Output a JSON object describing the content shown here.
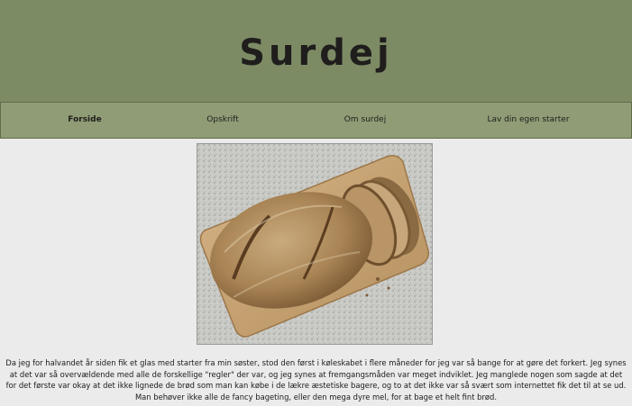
{
  "header": {
    "title": "Surdej"
  },
  "nav": {
    "items": [
      {
        "label": "Forside",
        "active": true
      },
      {
        "label": "Opskrift",
        "active": false
      },
      {
        "label": "Om surdej",
        "active": false
      },
      {
        "label": "Lav din egen starter",
        "active": false
      }
    ]
  },
  "main": {
    "image_subject": "sourdough-bread-on-cutting-board",
    "paragraph": "Da jeg for halvandet år siden fik et glas med starter fra min søster, stod den først i køleskabet i flere måneder for jeg var så bange for at gøre det forkert. Jeg synes at det var så overvældende med alle de forskellige \"regler\" der var, og jeg synes at fremgangsmåden var meget indviklet. Jeg manglede nogen som sagde at det for det første var okay at det ikke lignede de brød som man kan købe i de lækre æstetiske bagere, og to at det ikke var så svært som internettet fik det til at se ud. Man behøver ikke alle de fancy bageting, eller den mega dyre mel, for at bage et helt fint brød."
  },
  "colors": {
    "header_bg": "#7d8b65",
    "nav_bg": "#8f9c75",
    "page_bg": "#ebebeb",
    "text": "#1f1e1c"
  }
}
